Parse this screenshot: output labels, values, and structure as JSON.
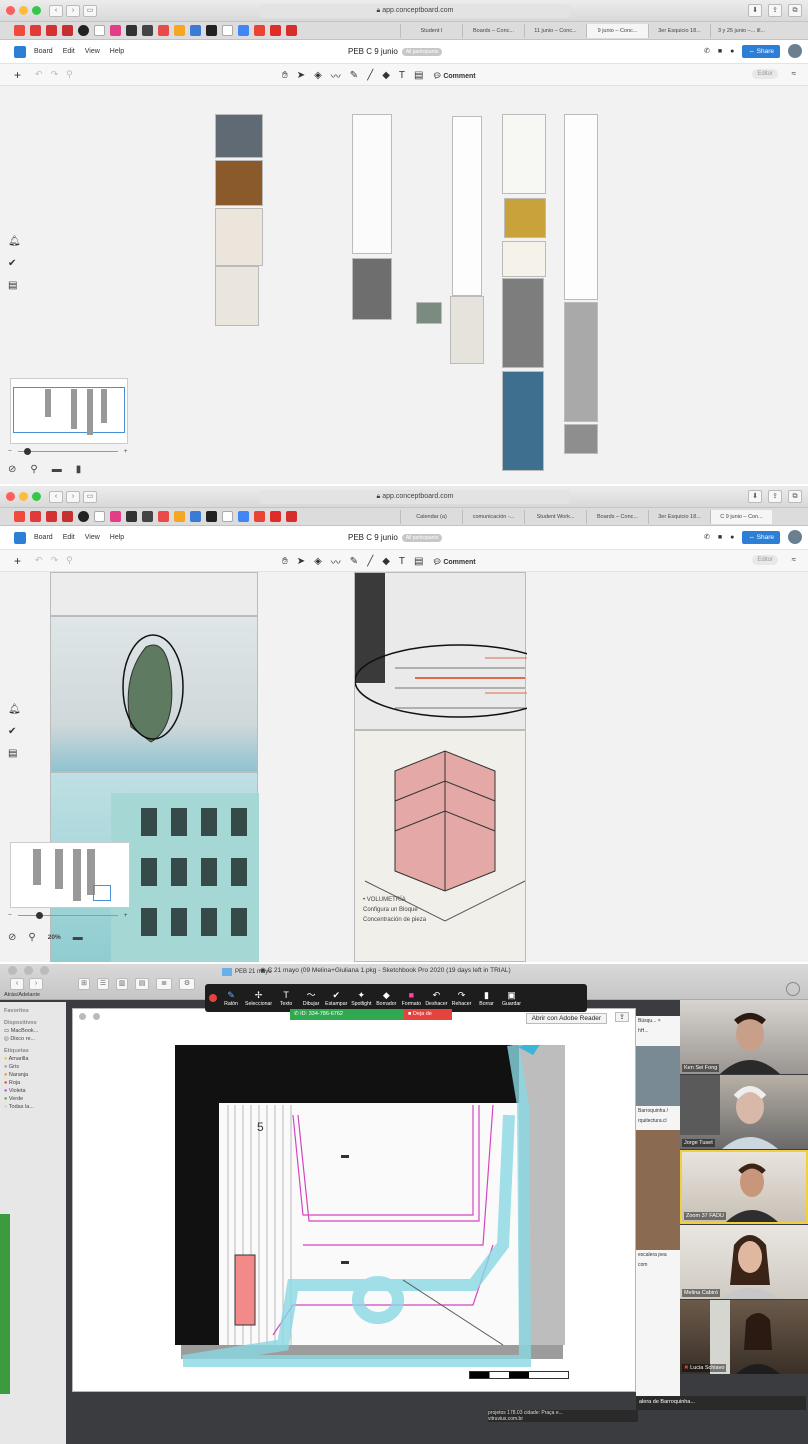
{
  "shot1": {
    "url": "app.conceptboard.com",
    "tabs": [
      "Student I",
      "Boards – Conc...",
      "11 junio – Conc...",
      "9 junio – Conc...",
      "3er Esquicio 18...",
      "3 y 25 junio –... ill..."
    ],
    "menu": [
      "Board",
      "Edit",
      "View",
      "Help"
    ],
    "board_title": "PEB C 9 junio",
    "participants": "All participants",
    "share_label": "Share",
    "comment_label": "Comment",
    "editor_label": "Editor"
  },
  "shot2": {
    "url": "app.conceptboard.com",
    "tabs": [
      "Calendar (a)",
      "comunicación -...",
      "Student Work...",
      "Boards – Conc...",
      "3er Esquicio 18...",
      "C 9 junio – Con..."
    ],
    "menu": [
      "Board",
      "Edit",
      "View",
      "Help"
    ],
    "board_title": "PEB C 9 junio",
    "participants": "All participants",
    "share_label": "Share",
    "comment_label": "Comment",
    "editor_label": "Editor",
    "zoom_level": "20%"
  },
  "shot3": {
    "window_title": "C 21 mayo (09 Melina+Giuliana 1.pkg - Sketchbook Pro 2020 (19 days left in TRIAL)",
    "finder_nav": "Atrás/Adelante",
    "finder_folder": "PEB 21 mayo",
    "sidebar": {
      "favoritos": "Favoritos",
      "dispositivos": "Dispositivos",
      "devices": [
        "MacBook...",
        "Disco re..."
      ],
      "etiquetas": "Etiquetas",
      "tags": [
        {
          "label": "Amarilla",
          "color": "#e8c23a"
        },
        {
          "label": "Gris",
          "color": "#9a9a9a"
        },
        {
          "label": "Naranja",
          "color": "#f08a2c"
        },
        {
          "label": "Roja",
          "color": "#e5433d"
        },
        {
          "label": "Violeta",
          "color": "#a056d1"
        },
        {
          "label": "Verde",
          "color": "#3fae3f"
        },
        {
          "label": "Todas la...",
          "color": "#d0d0d0"
        }
      ]
    },
    "annotate_tools": [
      "Ratón",
      "Seleccionar",
      "Texto",
      "Dibujar",
      "Estampar",
      "Spotlight",
      "Borrador",
      "Formato",
      "Deshacer",
      "Rehacer",
      "Borrar",
      "Guardar"
    ],
    "meeting_id": "ID: 334-786-6762",
    "stop_share": "Deja de",
    "adobe_button": "Abrir con Adobe Reader",
    "plan_label": "5",
    "participants": [
      "Ken Sei Fong",
      "Jorge Tuset",
      "Zoom 37 FADU",
      "Melina Cabiró",
      "Lucia Schiavo"
    ],
    "bg_web": [
      "Búsqu... ×",
      "hH...",
      "Barroquinha /",
      "rquitectura.cl",
      "escalera pea",
      "com",
      "alera de Barroquinha...",
      "projetos 178.03 cidade: Praça e...",
      "vitruvius.com.br"
    ]
  }
}
